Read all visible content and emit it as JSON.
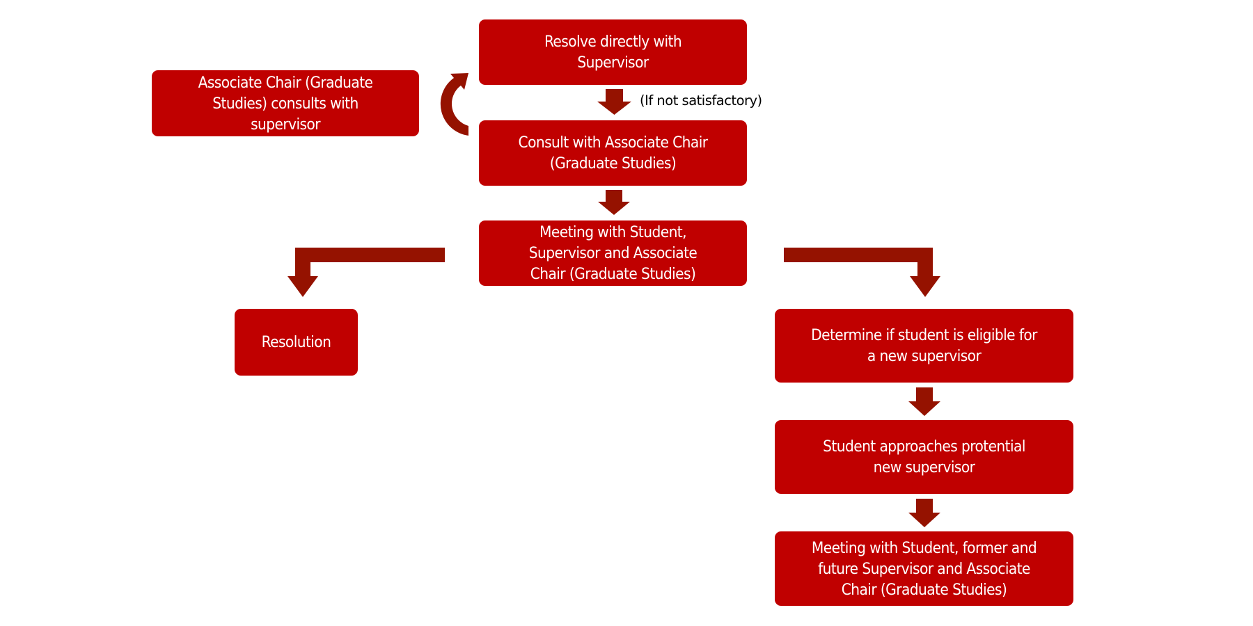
{
  "diagram": {
    "type": "flowchart",
    "colors": {
      "node_fill": "#c00000",
      "node_text": "#ffffff",
      "arrow_fill": "#951200",
      "label_text": "#000000",
      "background": "#ffffff"
    },
    "nodes": {
      "resolve": {
        "label": "Resolve directly with\nSupervisor"
      },
      "assoc_consults": {
        "label": "Associate Chair (Graduate\nStudies) consults with\nsupervisor"
      },
      "consult": {
        "label": "Consult with Associate Chair\n(Graduate Studies)"
      },
      "meeting": {
        "label": "Meeting with Student,\nSupervisor and Associate\nChair (Graduate Studies)"
      },
      "resolution": {
        "label": "Resolution"
      },
      "determine": {
        "label": "Determine if student is eligible for\na new supervisor"
      },
      "approach": {
        "label": "Student approaches protential\nnew supervisor"
      },
      "final_meeting": {
        "label": "Meeting with Student, former and\nfuture Supervisor and Associate\nChair (Graduate Studies)"
      }
    },
    "edges": [
      {
        "from": "resolve",
        "to": "consult",
        "label": "(If not satisfactory)",
        "style": "block-arrow-down"
      },
      {
        "from": "consult",
        "to": "resolve",
        "label": "",
        "style": "curved-arrow",
        "via": "assoc_consults"
      },
      {
        "from": "consult",
        "to": "meeting",
        "label": "",
        "style": "block-arrow-down"
      },
      {
        "from": "meeting",
        "to": "resolution",
        "label": "",
        "style": "bent-arrow-left-down"
      },
      {
        "from": "meeting",
        "to": "determine",
        "label": "",
        "style": "bent-arrow-right-down"
      },
      {
        "from": "determine",
        "to": "approach",
        "label": "",
        "style": "block-arrow-down"
      },
      {
        "from": "approach",
        "to": "final_meeting",
        "label": "",
        "style": "block-arrow-down"
      }
    ]
  }
}
